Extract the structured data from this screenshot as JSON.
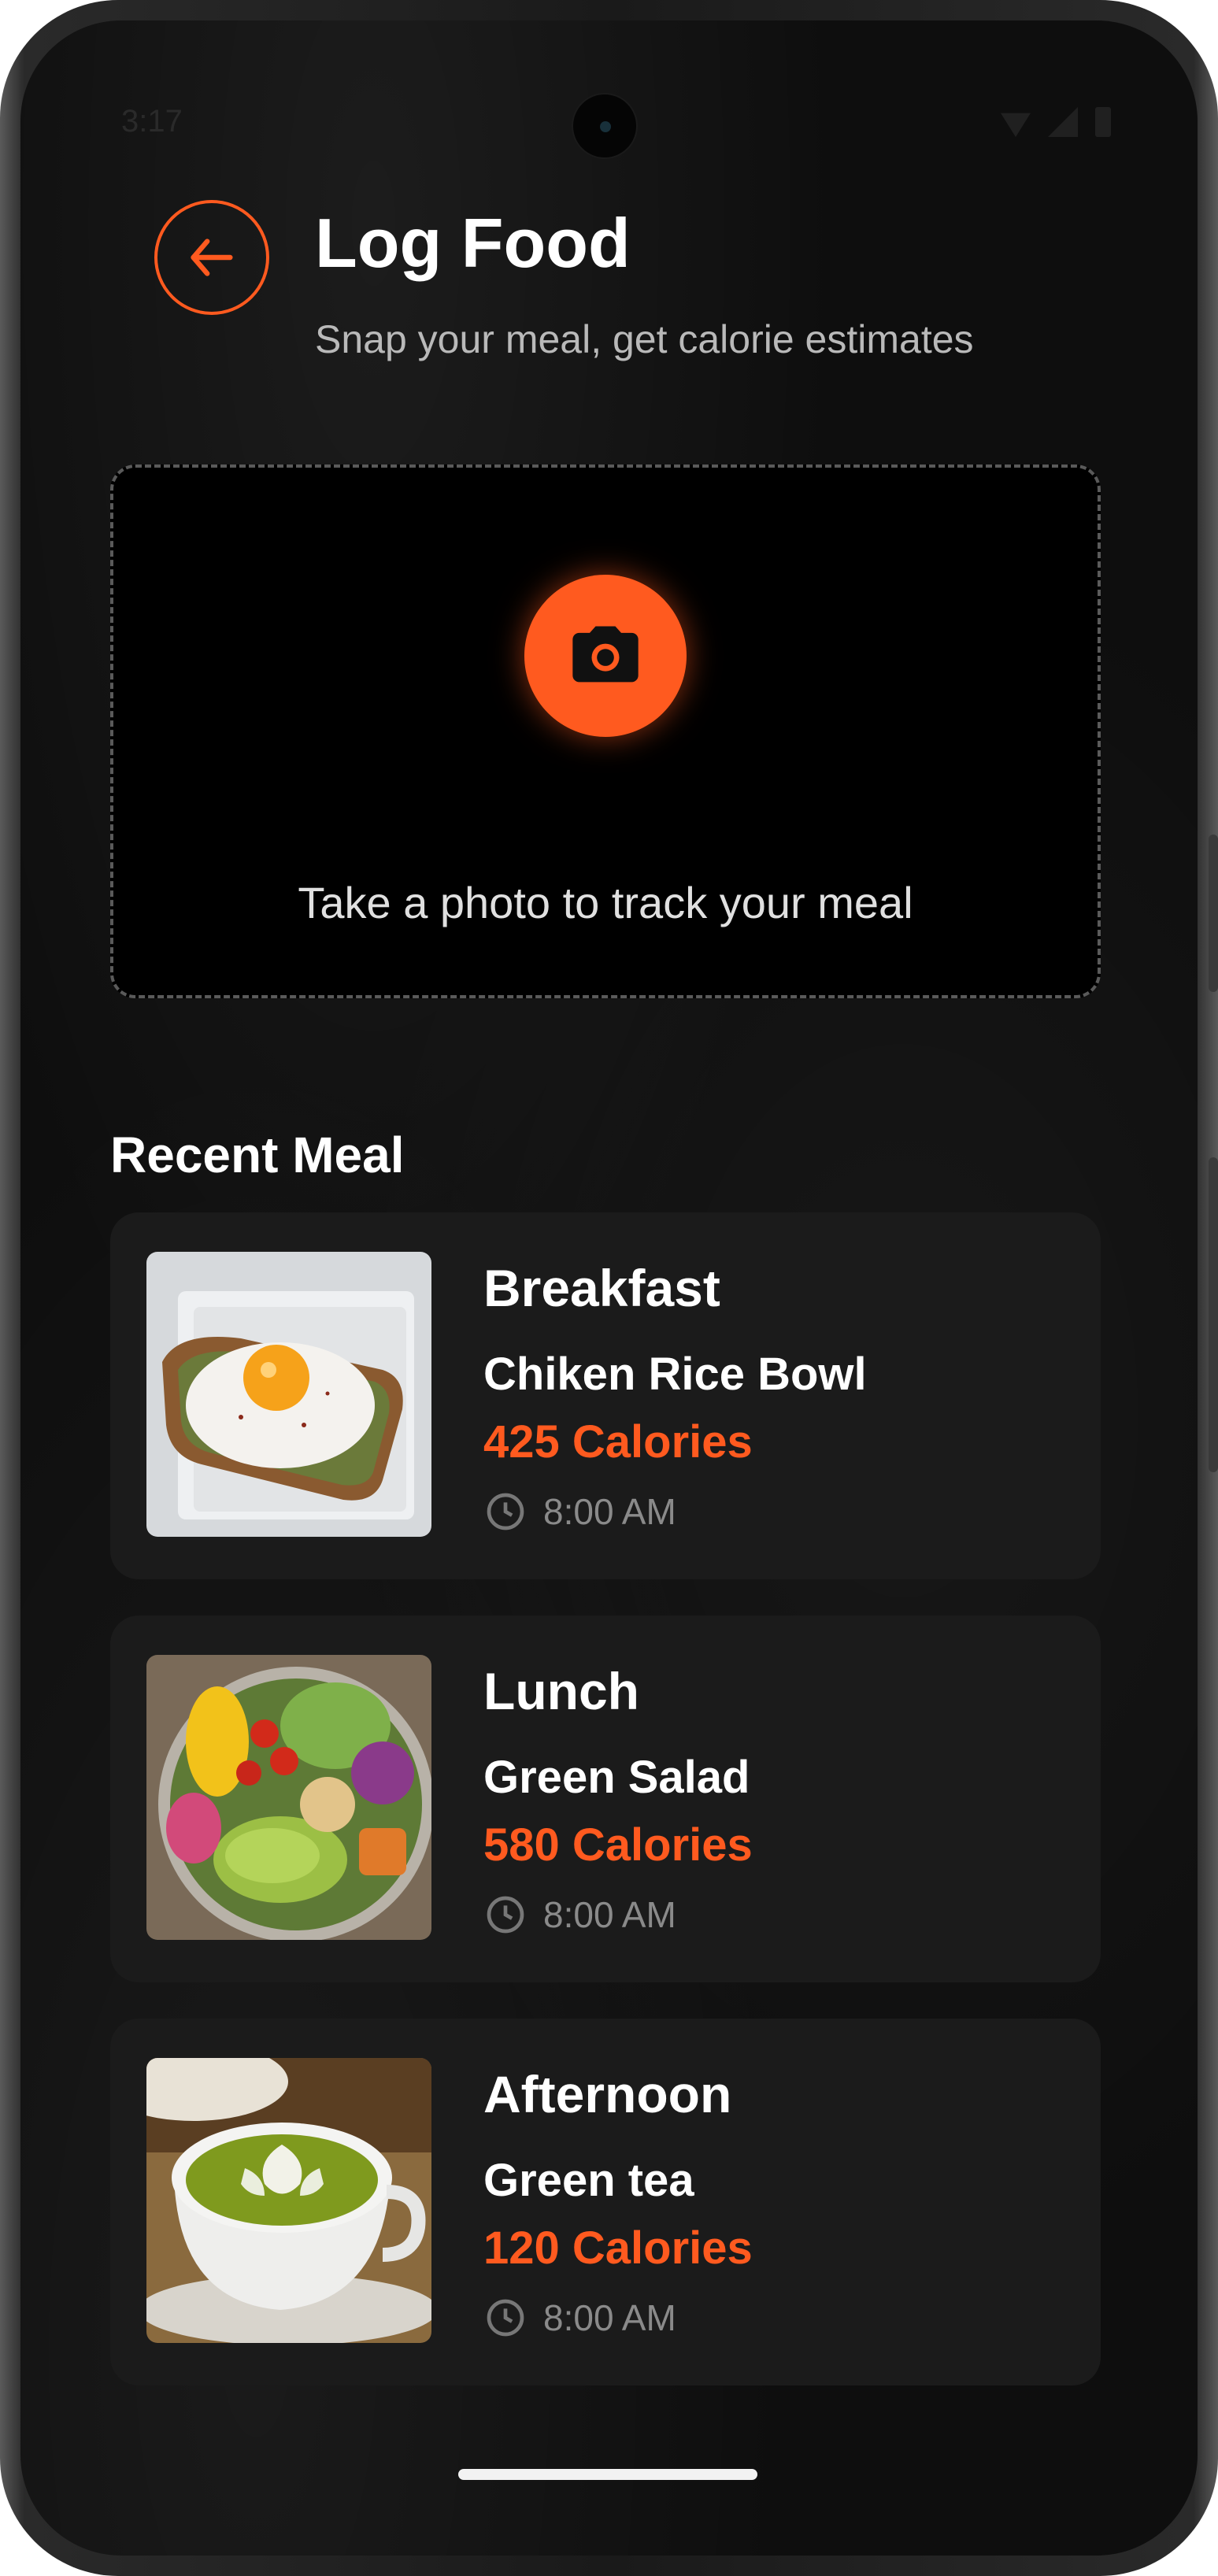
{
  "status_bar": {
    "time": "3:17"
  },
  "header": {
    "title": "Log Food",
    "subtitle": "Snap your meal, get calorie estimates",
    "back_icon": "arrow-left-icon"
  },
  "photo": {
    "prompt": "Take a photo to track your meal",
    "button_icon": "camera-icon"
  },
  "recent": {
    "title": "Recent Meal",
    "meals": [
      {
        "type": "Breakfast",
        "name": "Chiken Rice Bowl",
        "calories": "425 Calories",
        "time": "8:00 AM",
        "image": "egg-toast"
      },
      {
        "type": "Lunch",
        "name": "Green Salad",
        "calories": "580 Calories",
        "time": "8:00 AM",
        "image": "salad-bowl"
      },
      {
        "type": "Afternoon",
        "name": "Green tea",
        "calories": "120 Calories",
        "time": "8:00 AM",
        "image": "matcha-latte"
      }
    ]
  },
  "colors": {
    "accent": "#ff5a1f",
    "background": "#0e0e0e",
    "card": "#1b1b1b",
    "muted_text": "#8a8a8a"
  }
}
